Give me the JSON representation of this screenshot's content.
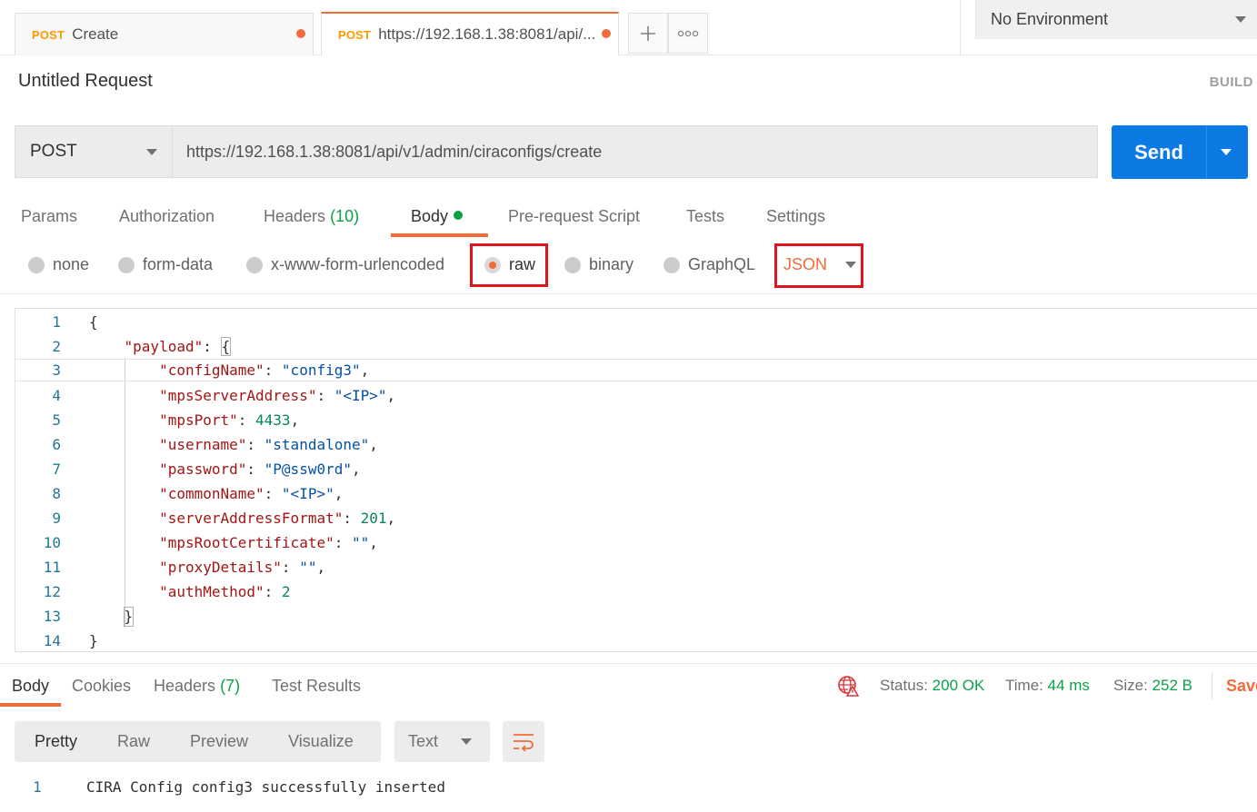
{
  "tabs": [
    {
      "method": "POST",
      "title": "Create"
    },
    {
      "method": "POST",
      "title": "https://192.168.1.38:8081/api/..."
    }
  ],
  "tab_actions": {
    "new_tab": "+",
    "more": "ooo"
  },
  "environment": {
    "selected": "No Environment"
  },
  "request": {
    "title": "Untitled Request",
    "build_label": "BUILD",
    "method": "POST",
    "url": "https://192.168.1.38:8081/api/v1/admin/ciraconfigs/create",
    "send_label": "Send"
  },
  "request_tabs": {
    "params": "Params",
    "authorization": "Authorization",
    "headers": "Headers",
    "headers_count": "(10)",
    "body": "Body",
    "prerequest": "Pre-request Script",
    "tests": "Tests",
    "settings": "Settings"
  },
  "body_types": {
    "none": "none",
    "form_data": "form-data",
    "urlencoded": "x-www-form-urlencoded",
    "raw": "raw",
    "binary": "binary",
    "graphql": "GraphQL",
    "language": "JSON",
    "selected": "raw"
  },
  "editor": {
    "line_numbers": [
      "1",
      "2",
      "3",
      "4",
      "5",
      "6",
      "7",
      "8",
      "9",
      "10",
      "11",
      "12",
      "13",
      "14"
    ],
    "lines": [
      {
        "indent": "",
        "key": "",
        "value": "",
        "vtype": "",
        "raw": "{"
      },
      {
        "indent": "    ",
        "key": "\"payload\"",
        "sep": ": ",
        "value": "{",
        "vtype": "p",
        "tail": ""
      },
      {
        "indent": "        ",
        "key": "\"configName\"",
        "sep": ": ",
        "value": "\"config3\"",
        "vtype": "s",
        "tail": ","
      },
      {
        "indent": "        ",
        "key": "\"mpsServerAddress\"",
        "sep": ": ",
        "value": "\"<IP>\"",
        "vtype": "s",
        "tail": ","
      },
      {
        "indent": "        ",
        "key": "\"mpsPort\"",
        "sep": ": ",
        "value": "4433",
        "vtype": "n",
        "tail": ","
      },
      {
        "indent": "        ",
        "key": "\"username\"",
        "sep": ": ",
        "value": "\"standalone\"",
        "vtype": "s",
        "tail": ","
      },
      {
        "indent": "        ",
        "key": "\"password\"",
        "sep": ": ",
        "value": "\"P@ssw0rd\"",
        "vtype": "s",
        "tail": ","
      },
      {
        "indent": "        ",
        "key": "\"commonName\"",
        "sep": ": ",
        "value": "\"<IP>\"",
        "vtype": "s",
        "tail": ","
      },
      {
        "indent": "        ",
        "key": "\"serverAddressFormat\"",
        "sep": ": ",
        "value": "201",
        "vtype": "n",
        "tail": ","
      },
      {
        "indent": "        ",
        "key": "\"mpsRootCertificate\"",
        "sep": ": ",
        "value": "\"\"",
        "vtype": "s",
        "tail": ","
      },
      {
        "indent": "        ",
        "key": "\"proxyDetails\"",
        "sep": ": ",
        "value": "\"\"",
        "vtype": "s",
        "tail": ","
      },
      {
        "indent": "        ",
        "key": "\"authMethod\"",
        "sep": ": ",
        "value": "2",
        "vtype": "n",
        "tail": ""
      },
      {
        "indent": "    ",
        "key": "",
        "value": "",
        "vtype": "",
        "raw": "}"
      },
      {
        "indent": "",
        "key": "",
        "value": "",
        "vtype": "",
        "raw": "}"
      }
    ]
  },
  "response": {
    "tabs": {
      "body": "Body",
      "cookies": "Cookies",
      "headers": "Headers",
      "headers_count": "(7)",
      "test_results": "Test Results"
    },
    "status_label": "Status:",
    "status_value": "200 OK",
    "time_label": "Time:",
    "time_value": "44 ms",
    "size_label": "Size:",
    "size_value": "252 B",
    "save_label": "Save",
    "view_modes": [
      "Pretty",
      "Raw",
      "Preview",
      "Visualize"
    ],
    "format": "Text",
    "line_number": "1",
    "body_text": "CIRA Config config3 successfully inserted"
  },
  "colors": {
    "accent": "#f26b3a",
    "send": "#0b7be3",
    "method_post": "#ff9900",
    "success": "#0ca049",
    "highlight_box": "#e0141e"
  }
}
